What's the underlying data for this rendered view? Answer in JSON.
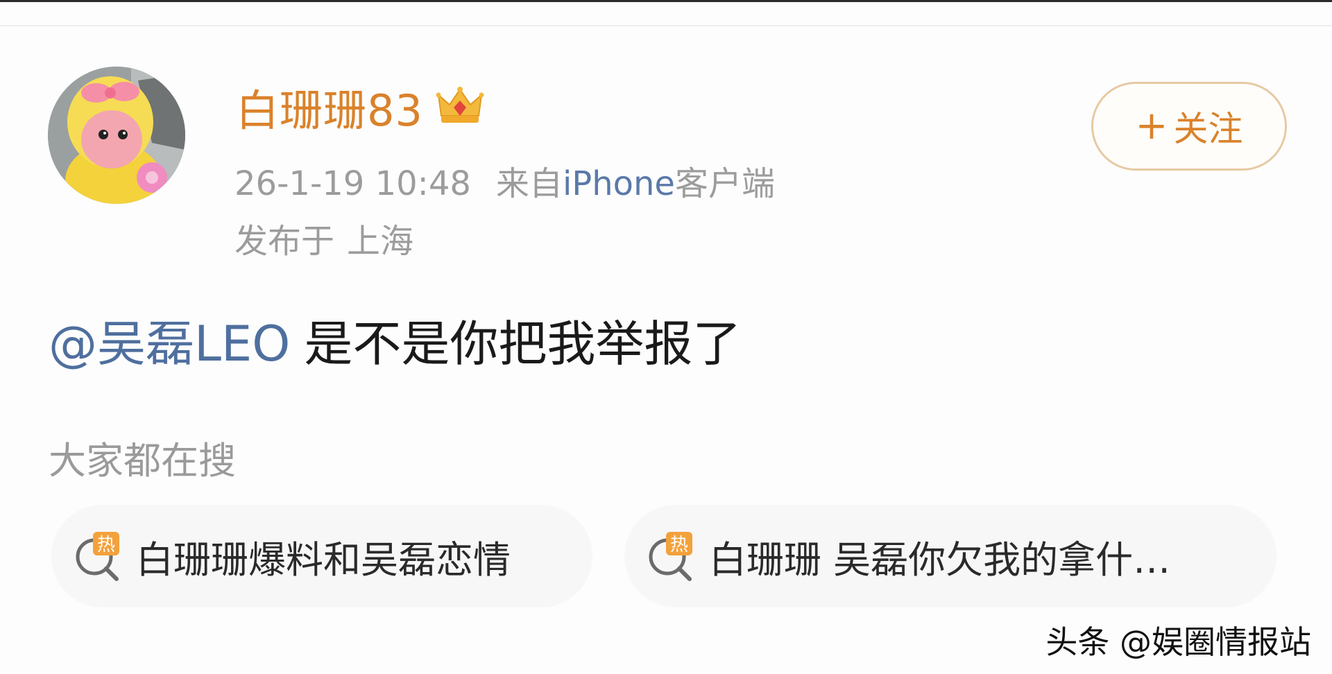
{
  "post": {
    "username": "白珊珊83",
    "timestamp": "26-1-19 10:48",
    "source_prefix": "来自",
    "source_brand": "iPhone",
    "source_suffix": "客户端",
    "location_label": "发布于",
    "location": "上海",
    "follow_plus": "+",
    "follow_label": "关注",
    "mention": "@吴磊LEO",
    "text": "是不是你把我举报了"
  },
  "trending": {
    "title": "大家都在搜",
    "hot_label": "热",
    "items": [
      {
        "label": "白珊珊爆料和吴磊恋情"
      },
      {
        "label": "白珊珊 吴磊你欠我的拿什…"
      }
    ]
  },
  "watermark": "头条 @娱圈情报站",
  "colors": {
    "accent_orange": "#d9822b",
    "link_blue": "#4f6f9f",
    "meta_gray": "#9c9c9c"
  },
  "icons": [
    "crown-icon",
    "hot-search-icon",
    "avatar"
  ]
}
